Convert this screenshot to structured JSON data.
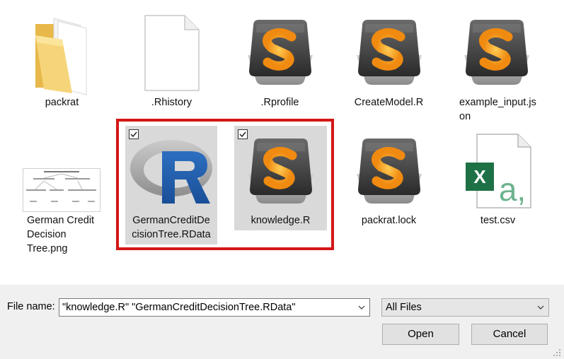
{
  "files": [
    {
      "id": "packrat-folder",
      "label": "packrat",
      "icon": "folder-icon"
    },
    {
      "id": "rhistory",
      "label": ".Rhistory",
      "icon": "blank-file-icon"
    },
    {
      "id": "rprofile",
      "label": ".Rprofile",
      "icon": "sublime-text-icon"
    },
    {
      "id": "createmodel",
      "label": "CreateModel.R",
      "icon": "sublime-text-icon"
    },
    {
      "id": "example-input",
      "label": "example_input.js\non",
      "icon": "sublime-text-icon"
    },
    {
      "id": "german-png",
      "label": "German Credit\nDecision\nTree.png",
      "icon": "image-thumbnail-icon"
    },
    {
      "id": "german-rdata",
      "label": "GermanCreditDe\ncisionTree.RData",
      "icon": "r-logo-icon",
      "selected": true
    },
    {
      "id": "knowledge",
      "label": "knowledge.R",
      "icon": "sublime-text-icon",
      "selected": true
    },
    {
      "id": "packrat-lock",
      "label": "packrat.lock",
      "icon": "sublime-text-icon"
    },
    {
      "id": "test-csv",
      "label": "test.csv",
      "icon": "excel-csv-icon"
    }
  ],
  "bottom": {
    "file_name_label": "File name:",
    "file_name_value": "\"knowledge.R\" \"GermanCreditDecisionTree.RData\"",
    "filter_value": "All Files",
    "open_label": "Open",
    "cancel_label": "Cancel"
  },
  "colors": {
    "highlight": "#d41616",
    "selection": "#d9d9d9",
    "sublime_orange": "#f7931e"
  }
}
